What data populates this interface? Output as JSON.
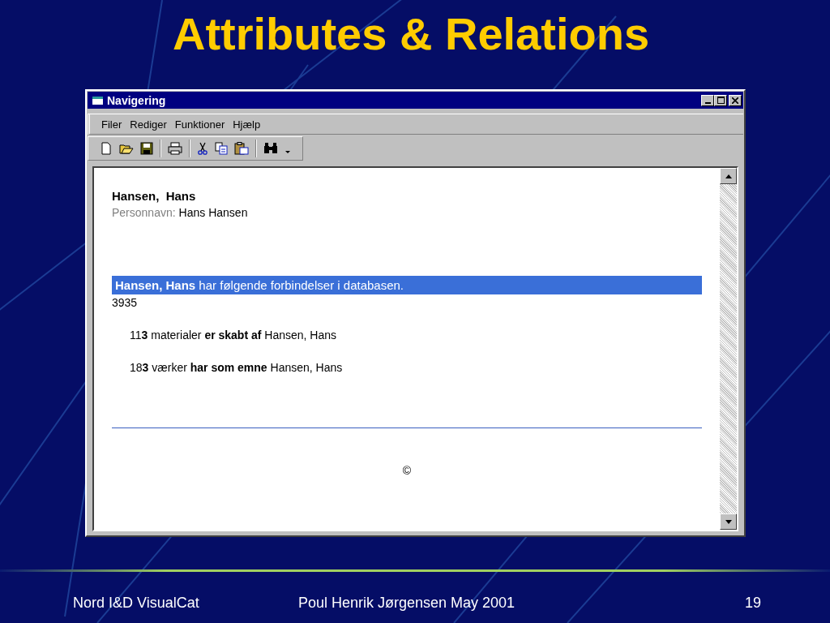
{
  "slide_title": "Attributes & Relations",
  "window": {
    "title": "Navigering",
    "menu": [
      "Filer",
      "Rediger",
      "Funktioner",
      "Hjælp"
    ],
    "content": {
      "heading": "Hansen,  Hans",
      "field_label": "Personnavn:",
      "field_value": "Hans Hansen",
      "banner": {
        "text": "**Hansen, Hans** har følgende forbindelser i databasen.",
        "highlighted": true
      },
      "count": "3935",
      "relations": [
        "11**3** materialer **er skabt af** Hansen, Hans",
        "18**3** værker **har som emne** Hansen, Hans"
      ],
      "copyright": "©"
    }
  },
  "footer": {
    "left": "Nord I&D VisualCat",
    "center": "Poul Henrik Jørgensen May 2001",
    "page": "19"
  }
}
